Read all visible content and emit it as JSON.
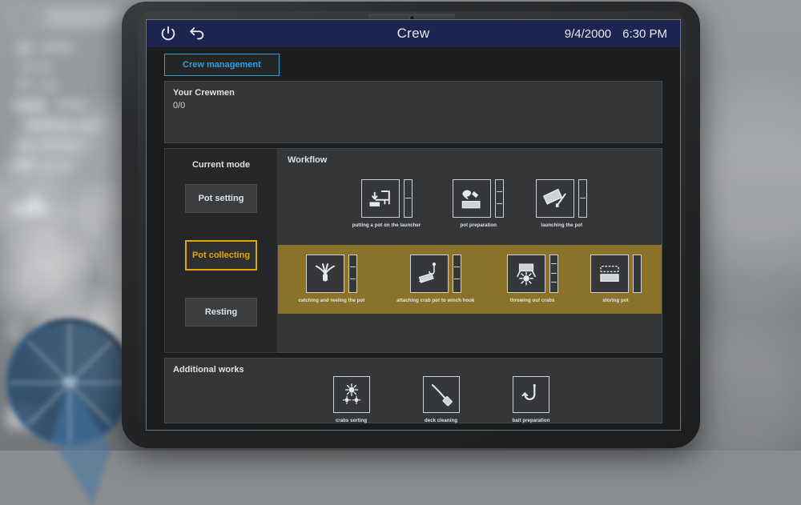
{
  "titlebar": {
    "power_icon": "power-icon",
    "back_icon": "back-arrow-icon",
    "title": "Crew",
    "date": "9/4/2000",
    "time": "6:30 PM"
  },
  "tabs": [
    {
      "label": "Crew management",
      "active": true
    }
  ],
  "crewmen": {
    "title": "Your Crewmen",
    "count": "0/0"
  },
  "modes": {
    "title": "Current mode",
    "buttons": [
      {
        "label": "Pot setting",
        "active": false
      },
      {
        "label": "Pot collecting",
        "active": true
      },
      {
        "label": "Resting",
        "active": false
      }
    ]
  },
  "workflow": {
    "title": "Workflow",
    "row1": [
      {
        "label": "putting a pot on the launcher",
        "icon": "pot-launcher-icon",
        "segments": 2
      },
      {
        "label": "pot preparation",
        "icon": "bait-pot-icon",
        "segments": 3
      },
      {
        "label": "launching the pot",
        "icon": "launching-pot-icon",
        "segments": 2
      }
    ],
    "row2": [
      {
        "label": "catching and reeling the pot",
        "icon": "grapple-hook-icon",
        "segments": 3
      },
      {
        "label": "attaching crab pot to winch hook",
        "icon": "winch-hook-icon",
        "segments": 3
      },
      {
        "label": "throwing out crabs",
        "icon": "crab-dump-icon",
        "segments": 4
      },
      {
        "label": "storing pot",
        "icon": "stacking-pot-icon",
        "segments": 1
      }
    ]
  },
  "additional": {
    "title": "Additional works",
    "items": [
      {
        "label": "crabs sorting",
        "icon": "crab-sorting-icon"
      },
      {
        "label": "deck cleaning",
        "icon": "broom-icon"
      },
      {
        "label": "bait preparation",
        "icon": "fish-hook-icon"
      }
    ]
  },
  "colors": {
    "header_blue": "#1b2550",
    "tab_blue": "#2d9fe0",
    "accent_gold": "#e0a800",
    "highlight_row": "#8a7329",
    "panel_bg": "#343638"
  }
}
